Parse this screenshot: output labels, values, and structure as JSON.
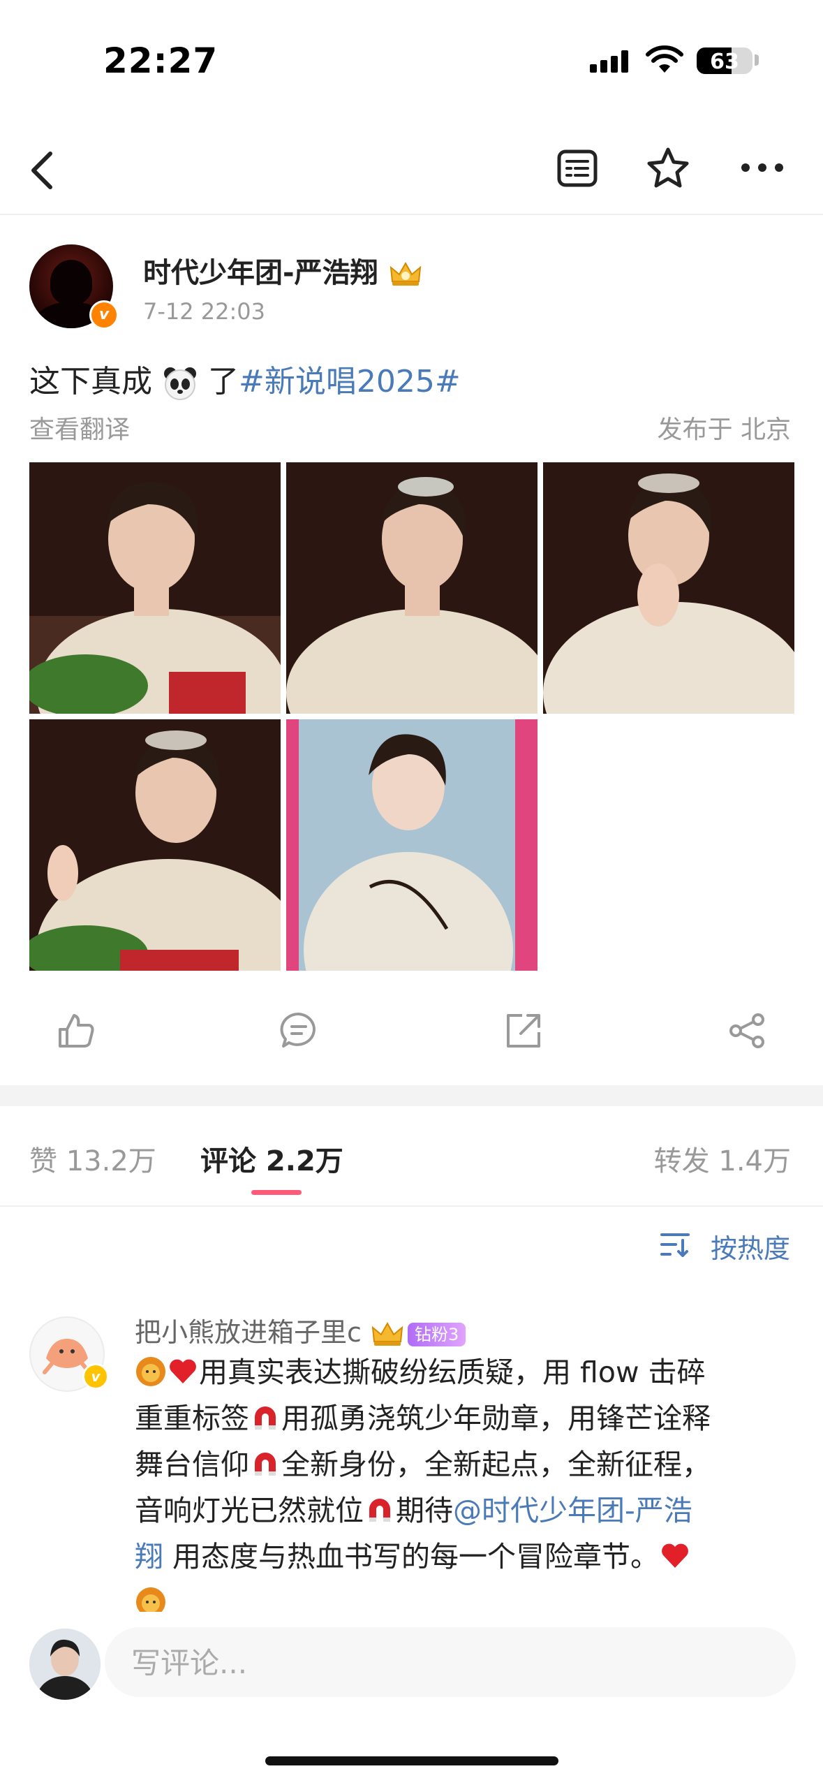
{
  "status_bar": {
    "time": "22:27",
    "battery": "63",
    "battery_level": 0.63
  },
  "nav": {
    "back_icon": "chevron-left-icon",
    "icons": [
      "article-icon",
      "star-icon",
      "more-icon"
    ]
  },
  "post": {
    "author": "时代少年团-严浩翔",
    "time": "7-12 22:03",
    "text_prefix": "这下真成",
    "text_suffix": "了",
    "hashtag": "#新说唱2025#",
    "translate_label": "查看翻译",
    "location": "发布于 北京",
    "photo_count": 5
  },
  "actions": [
    "like-icon",
    "comment-icon",
    "repost-icon",
    "share-icon"
  ],
  "tabs": {
    "likes": "赞 13.2万",
    "comments": "评论 2.2万",
    "reposts": "转发 1.4万"
  },
  "sort": {
    "label": "按热度"
  },
  "comment": {
    "user": "把小熊放进箱子里c",
    "badge": "钻粉3",
    "line1": "用真实表达撕破纷纭质疑，用 flow 击碎",
    "line2a": "重重标签",
    "line2b": "用孤勇浇筑少年勋章，用锋芒诠释",
    "line3a": "舞台信仰",
    "line3b": "全新身份，全新起点，全新征程，",
    "line4a": "音响灯光已然就位",
    "line4b": "期待",
    "mention_a": "@时代少年团-严浩",
    "mention_b": "翔",
    "line5": "用态度与热血书写的每一个冒险章节。"
  },
  "input": {
    "placeholder": "写评论..."
  },
  "colors": {
    "link": "#4a7ab7",
    "accent": "#ff5a78",
    "verified": "#ff8200"
  }
}
